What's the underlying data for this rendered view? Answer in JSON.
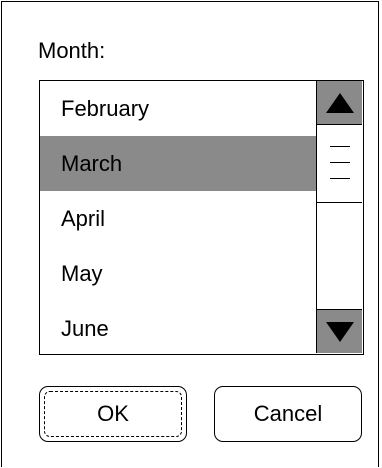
{
  "dialog": {
    "label": "Month:",
    "list": {
      "items": [
        {
          "label": "February",
          "selected": false
        },
        {
          "label": "March",
          "selected": true
        },
        {
          "label": "April",
          "selected": false
        },
        {
          "label": "May",
          "selected": false
        },
        {
          "label": "June",
          "selected": false
        }
      ],
      "selected_value": "March"
    },
    "scrollbar": {
      "up_icon": "arrow-up-icon",
      "down_icon": "arrow-down-icon",
      "thumb_icon": "grip-lines-icon"
    },
    "buttons": {
      "ok_label": "OK",
      "cancel_label": "Cancel"
    }
  },
  "colors": {
    "selection": "#8a8a8a",
    "border": "#000000",
    "background": "#ffffff"
  }
}
